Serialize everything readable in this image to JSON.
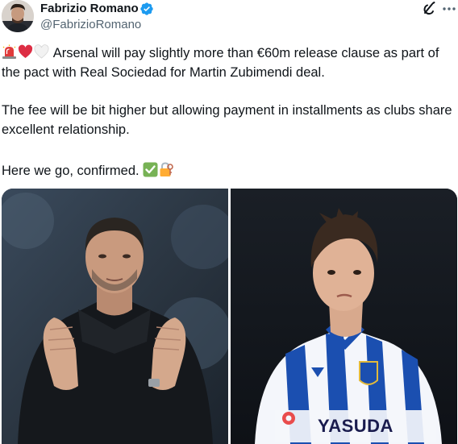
{
  "author": {
    "display_name": "Fabrizio Romano",
    "handle": "@FabrizioRomano",
    "verified": true,
    "avatar_icon": "profile-photo"
  },
  "actions": {
    "grok_icon": "grok-icon",
    "more_icon": "more-horizontal-icon"
  },
  "tweet": {
    "paragraph1_emojis": [
      "siren-emoji",
      "red-heart-emoji",
      "white-heart-emoji"
    ],
    "paragraph1": "Arsenal will pay slightly more than €60m release clause as part of the pact with Real Sociedad for Martin Zubimendi deal.",
    "paragraph2": "The fee will be bit higher but allowing payment in installments as clubs share excellent relationship.",
    "paragraph3": "Here we go, confirmed.",
    "paragraph3_emojis": [
      "check-mark-button-emoji",
      "locked-with-key-emoji"
    ]
  },
  "media": {
    "left_photo": "manager-applauding",
    "right_photo": "player-in-real-sociedad-kit",
    "shirt_sponsor": "YASUDA"
  },
  "colors": {
    "text": "#0f1419",
    "secondary": "#536471",
    "verified_blue": "#1d9bf0",
    "sociedad_blue": "#1b4fb0"
  }
}
